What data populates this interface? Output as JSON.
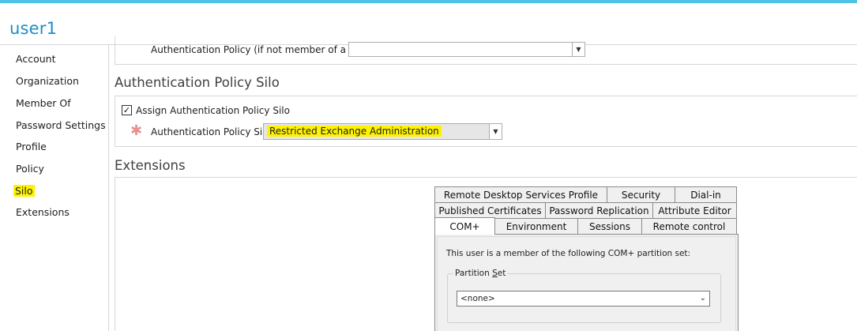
{
  "window": {
    "title": "user1"
  },
  "sidebar": {
    "items": [
      {
        "label": "Account"
      },
      {
        "label": "Organization"
      },
      {
        "label": "Member Of"
      },
      {
        "label": "Password Settings"
      },
      {
        "label": "Profile"
      },
      {
        "label": "Policy"
      },
      {
        "label": "Silo"
      },
      {
        "label": "Extensions"
      }
    ],
    "selected": "Silo"
  },
  "auth_policy": {
    "label": "Authentication Policy (if not member of a Silo):",
    "value": ""
  },
  "silo_section": {
    "header": "Authentication Policy Silo",
    "assign_label": "Assign Authentication Policy Silo",
    "assign_checked": true,
    "silo_label": "Authentication Policy Silo:",
    "silo_value": "Restricted Exchange Administration"
  },
  "extensions": {
    "header": "Extensions",
    "tabs_row1": [
      "Remote Desktop Services Profile",
      "Security",
      "Dial-in"
    ],
    "tabs_row2": [
      "Published Certificates",
      "Password Replication",
      "Attribute Editor"
    ],
    "tabs_row3": [
      "COM+",
      "Environment",
      "Sessions",
      "Remote control"
    ],
    "active_tab": "COM+",
    "complus": {
      "description": "This user is a member of the following COM+ partition set:",
      "group_label_pre": "Partition ",
      "group_label_ul": "S",
      "group_label_post": "et",
      "select_value": "<none>"
    }
  },
  "colors": {
    "accent": "#1b8ec7",
    "highlight": "#fff200",
    "topbar": "#4fc3e6"
  }
}
